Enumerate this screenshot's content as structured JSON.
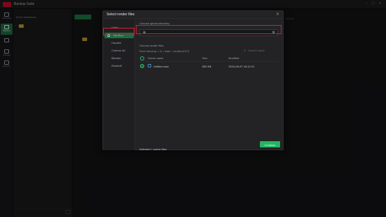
{
  "app": {
    "title": "Backup Suite",
    "subtitle": "",
    "window_controls": [
      "–",
      "▢",
      "✕"
    ]
  },
  "nav": {
    "items": [
      {
        "label": "Overview",
        "icon": "gauge-icon",
        "active": false
      },
      {
        "label": "Backup",
        "icon": "backup-icon",
        "active": true
      },
      {
        "label": "",
        "icon": "blank-icon",
        "active": false
      },
      {
        "label": "Policies",
        "icon": "policy-icon",
        "active": false
      },
      {
        "label": "Reports",
        "icon": "report-icon",
        "active": false
      }
    ]
  },
  "background": {
    "panel_title": "Excel selections",
    "tree_root": "",
    "green_button": "",
    "right_hint": "Upload"
  },
  "modal": {
    "title": "Select render files",
    "close": "✕",
    "sidebar": [
      {
        "label": "Video",
        "selected": false
      },
      {
        "label": "Lib files",
        "selected": true
      },
      {
        "label": "Houdini",
        "selected": false
      },
      {
        "label": "Cinema 4D",
        "selected": false
      },
      {
        "label": "Blender",
        "selected": false
      },
      {
        "label": "Redshift",
        "selected": false
      }
    ],
    "section1_title": "Choose upload directory",
    "picker": {
      "icon": "⊕",
      "value": "",
      "action": "⚙"
    },
    "section2_title": "Choose render files",
    "breadcrumb": "Root directory  >  D  >  task  >  renders1073",
    "search_placeholder": "Search name",
    "columns": {
      "name": "Scene name",
      "size": "Size",
      "modified": "Modified"
    },
    "rows": [
      {
        "name": "Untitled.max",
        "size": "380 KB",
        "modified": "2024-06-07 18:12:21"
      }
    ],
    "footer": {
      "prefix": "Selected",
      "count": "1",
      "suffix": "scene files"
    },
    "continue_label": "Continue"
  },
  "colors": {
    "accent": "#24b562",
    "selected_bg": "#1d6a42",
    "highlight": "#d3202e",
    "brand": "#c8102e"
  }
}
